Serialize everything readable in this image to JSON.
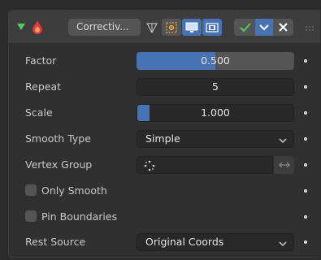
{
  "header": {
    "modifier_name": "Correctiv...",
    "icons": {
      "expand": "expand-triangle-icon",
      "modifier": "smooth-corrective-icon",
      "on_cage": "on-cage-icon",
      "edit_mode": "edit-mode-icon",
      "realtime": "realtime-display-icon",
      "render": "render-icon",
      "apply": "checkmark-icon",
      "menu": "chevron-down-icon",
      "delete": "close-icon",
      "drag": "drag-grip-icon"
    }
  },
  "properties": {
    "factor": {
      "label": "Factor",
      "value": "0.500",
      "fraction": 0.5
    },
    "repeat": {
      "label": "Repeat",
      "value": "5"
    },
    "scale": {
      "label": "Scale",
      "value": "1.000",
      "fraction": 0.08
    },
    "smooth_type": {
      "label": "Smooth Type",
      "value": "Simple"
    },
    "vertex_group": {
      "label": "Vertex Group",
      "value": ""
    },
    "only_smooth": {
      "label": "Only Smooth",
      "checked": false
    },
    "pin_boundaries": {
      "label": "Pin Boundaries",
      "checked": false
    },
    "rest_source": {
      "label": "Rest Source",
      "value": "Original Coords"
    }
  },
  "colors": {
    "accent": "#4772b3",
    "check_green": "#5ac85a",
    "modifier_orange": "#e57a2c"
  }
}
